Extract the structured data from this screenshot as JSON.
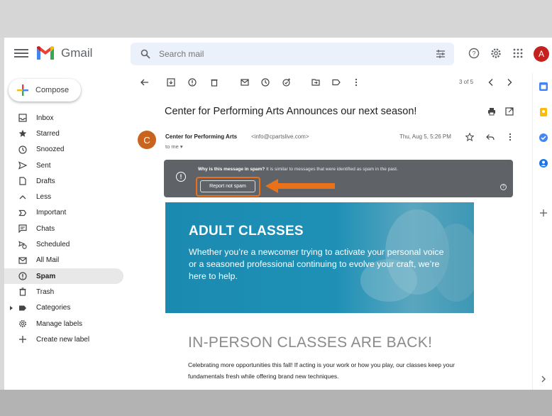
{
  "app": {
    "name": "Gmail",
    "avatar_letter": "A"
  },
  "search": {
    "placeholder": "Search mail"
  },
  "compose": {
    "label": "Compose"
  },
  "sidebar": {
    "items": [
      {
        "label": "Inbox",
        "icon": "inbox-icon"
      },
      {
        "label": "Starred",
        "icon": "star-icon"
      },
      {
        "label": "Snoozed",
        "icon": "clock-icon"
      },
      {
        "label": "Sent",
        "icon": "send-icon"
      },
      {
        "label": "Drafts",
        "icon": "draft-icon"
      },
      {
        "label": "Less",
        "icon": "chevron-up-icon"
      },
      {
        "label": "Important",
        "icon": "important-icon"
      },
      {
        "label": "Chats",
        "icon": "chat-icon"
      },
      {
        "label": "Scheduled",
        "icon": "scheduled-icon"
      },
      {
        "label": "All Mail",
        "icon": "mail-icon"
      },
      {
        "label": "Spam",
        "icon": "spam-icon",
        "active": true
      },
      {
        "label": "Trash",
        "icon": "trash-icon"
      },
      {
        "label": "Categories",
        "icon": "label-icon"
      },
      {
        "label": "Manage labels",
        "icon": "gear-icon"
      },
      {
        "label": "Create new label",
        "icon": "plus-icon"
      }
    ]
  },
  "toolbar": {
    "pager": "3 of 5"
  },
  "message": {
    "subject": "Center for Performing Arts Announces our next season!",
    "sender_initial": "C",
    "sender_name": "Center for Performing Arts",
    "sender_email": "<info@cpartslive.com>",
    "to": "to me ▾",
    "date": "Thu, Aug 5, 5:26 PM"
  },
  "spam_banner": {
    "question": "Why is this message in spam?",
    "explanation": " It is similar to messages that were identified as spam in the past.",
    "button_label": "Report not spam"
  },
  "content": {
    "hero_title": "ADULT CLASSES",
    "hero_body": "Whether you’re a newcomer trying to activate your personal voice or a seasoned professional continuing to evolve your craft, we’re here to help.",
    "section_title": "IN-PERSON CLASSES ARE BACK!",
    "section_body": "Celebrating more opportunities this fall! If acting is your work or how you play, our classes keep your fundamentals fresh while offering brand new techniques."
  },
  "colors": {
    "highlight": "#e8711a",
    "banner": "#5f6368",
    "hero": "#1e90b6"
  }
}
